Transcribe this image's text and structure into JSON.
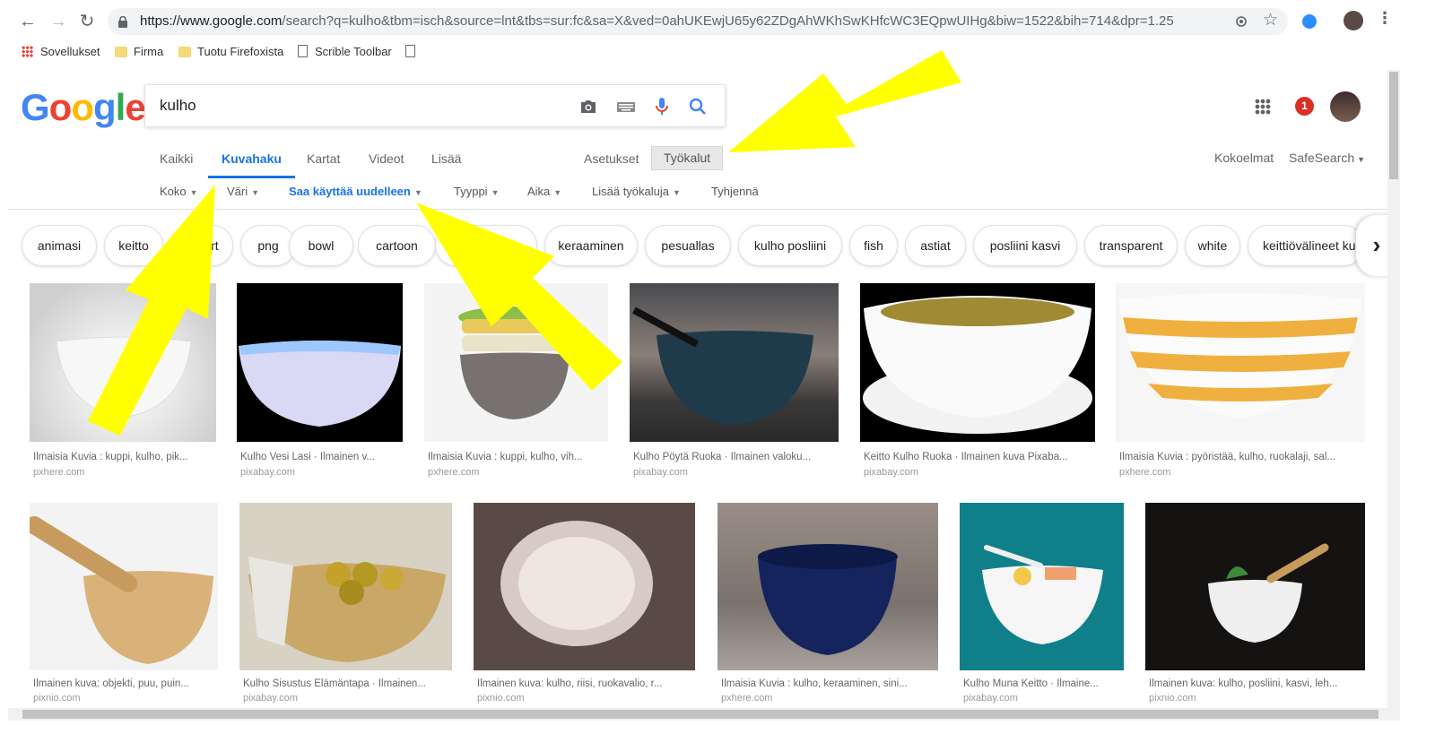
{
  "browser": {
    "url_host": "https://www.google.com",
    "url_rest": "/search?q=kulho&tbm=isch&source=lnt&tbs=sur:fc&sa=X&ved=0ahUKEwjU65y62ZDgAhWKhSwKHfcWC3EQpwUIHg&biw=1522&bih=714&dpr=1.25",
    "bookmarks": [
      "Sovellukset",
      "Firma",
      "Tuotu Firefoxista",
      "Scrible Toolbar"
    ]
  },
  "search": {
    "query": "kulho"
  },
  "header": {
    "notification_count": "1"
  },
  "tabs": [
    "Kaikki",
    "Kuvahaku",
    "Kartat",
    "Videot",
    "Lisää"
  ],
  "settings": {
    "asetukset": "Asetukset",
    "tyokalut": "Työkalut"
  },
  "right_links": {
    "kokoelmat": "Kokoelmat",
    "safesearch": "SafeSearch"
  },
  "filters": [
    "Koko",
    "Väri",
    "Saa käyttää uudelleen",
    "Tyyppi",
    "Aika",
    "Lisää työkaluja",
    "Tyhjennä"
  ],
  "chips": [
    "animasi",
    "keitto",
    "clipart",
    "png",
    "bowl",
    "cartoon",
    "ikea valko",
    "keraaminen",
    "pesuallas",
    "kulho posliini",
    "fish",
    "astiat",
    "posliini kasvi",
    "transparent",
    "white",
    "keittiövälineet kulho"
  ],
  "results": [
    {
      "caption": "Ilmaisia Kuvia : kuppi, kulho, pik...",
      "source": "pxhere.com"
    },
    {
      "caption": "Kulho Vesi Lasi · Ilmainen v...",
      "source": "pixabay.com"
    },
    {
      "caption": "Ilmaisia Kuvia : kuppi, kulho, vih...",
      "source": "pxhere.com"
    },
    {
      "caption": "Kulho Pöytä Ruoka · Ilmainen valoku...",
      "source": "pixabay.com"
    },
    {
      "caption": "Keitto Kulho Ruoka · Ilmainen kuva Pixaba...",
      "source": "pixabay.com"
    },
    {
      "caption": "Ilmaisia Kuvia : pyöristää, kulho, ruokalaji, sal...",
      "source": "pxhere.com"
    },
    {
      "caption": "Ilmainen kuva: objekti, puu, puin...",
      "source": "pixnio.com"
    },
    {
      "caption": "Kulho Sisustus Elämäntapa · Ilmainen...",
      "source": "pixabay.com"
    },
    {
      "caption": "Ilmainen kuva: kulho, riisi, ruokavalio, r...",
      "source": "pixnio.com"
    },
    {
      "caption": "Ilmaisia Kuvia : kulho, keraaminen, sini...",
      "source": "pxhere.com"
    },
    {
      "caption": "Kulho Muna Keitto · Ilmaine...",
      "source": "pixabay.com"
    },
    {
      "caption": "Ilmainen kuva: kulho, posliini, kasvi, leh...",
      "source": "pixnio.com"
    }
  ],
  "colors": {
    "accent": "#1a73e8",
    "arrow": "#ffff00",
    "badge": "#d93025"
  }
}
